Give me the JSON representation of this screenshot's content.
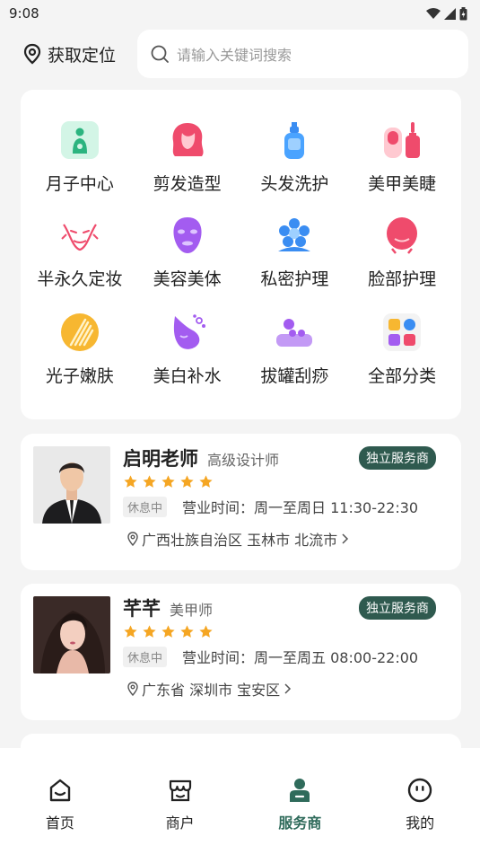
{
  "status_bar": {
    "time": "9:08"
  },
  "header": {
    "location_label": "获取定位",
    "search_placeholder": "请输入关键词搜索"
  },
  "categories": [
    {
      "label": "月子中心",
      "icon": "maternity-icon",
      "color": "#2bb47f"
    },
    {
      "label": "剪发造型",
      "icon": "hairstyle-icon",
      "color": "#ef4b6c"
    },
    {
      "label": "头发洗护",
      "icon": "shampoo-icon",
      "color": "#3a8df2"
    },
    {
      "label": "美甲美睫",
      "icon": "nail-polish-icon",
      "color": "#ef4b6c"
    },
    {
      "label": "半永久定妆",
      "icon": "face-makeup-icon",
      "color": "#ef4b6c"
    },
    {
      "label": "美容美体",
      "icon": "face-mask-icon",
      "color": "#a35cf0"
    },
    {
      "label": "私密护理",
      "icon": "flower-icon",
      "color": "#3a8df2"
    },
    {
      "label": "脸部护理",
      "icon": "face-care-icon",
      "color": "#ef4b6c"
    },
    {
      "label": "光子嫩肤",
      "icon": "light-skin-icon",
      "color": "#f5a623"
    },
    {
      "label": "美白补水",
      "icon": "whitening-icon",
      "color": "#a35cf0"
    },
    {
      "label": "拔罐刮痧",
      "icon": "cupping-icon",
      "color": "#a35cf0"
    },
    {
      "label": "全部分类",
      "icon": "all-categories-icon",
      "color": "#3a8df2"
    }
  ],
  "shops": [
    {
      "name": "启明老师",
      "role": "高级设计师",
      "badge": "独立服务商",
      "rating": 5,
      "status": "休息中",
      "hours": "营业时间：周一至周日 11:30-22:30",
      "address": "广西壮族自治区 玉林市 北流市"
    },
    {
      "name": "芊芊",
      "role": "美甲师",
      "badge": "独立服务商",
      "rating": 5,
      "status": "休息中",
      "hours": "营业时间：周一至周五 08:00-22:00",
      "address": "广东省 深圳市 宝安区"
    }
  ],
  "tabbar": {
    "tabs": [
      {
        "label": "首页",
        "icon": "home-icon"
      },
      {
        "label": "商户",
        "icon": "shop-icon"
      },
      {
        "label": "服务商",
        "icon": "provider-icon"
      },
      {
        "label": "我的",
        "icon": "profile-icon"
      }
    ],
    "active_index": 2,
    "active_color": "#2f6b5b"
  }
}
